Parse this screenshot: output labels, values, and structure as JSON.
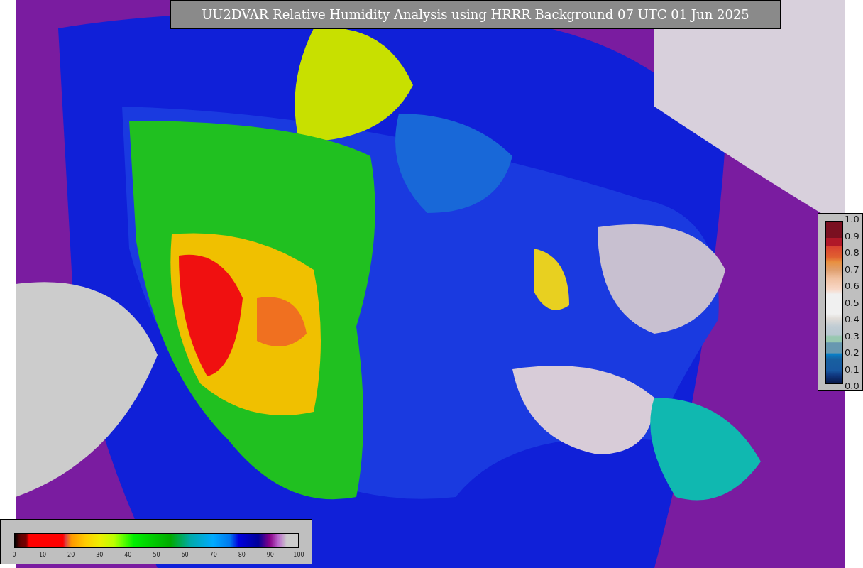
{
  "title": "UU2DVAR Relative Humidity Analysis using HRRR Background 07 UTC 01 Jun 2025",
  "colorbars": [
    {
      "kind": "horizontal",
      "ticks": [
        "0",
        "10",
        "20",
        "30",
        "40",
        "50",
        "60",
        "70",
        "80",
        "90",
        "100"
      ]
    },
    {
      "kind": "vertical",
      "ticks": [
        "1.0",
        "0.9",
        "0.8",
        "0.7",
        "0.6",
        "0.5",
        "0.4",
        "0.3",
        "0.2",
        "0.1",
        "0.0"
      ]
    }
  ]
}
